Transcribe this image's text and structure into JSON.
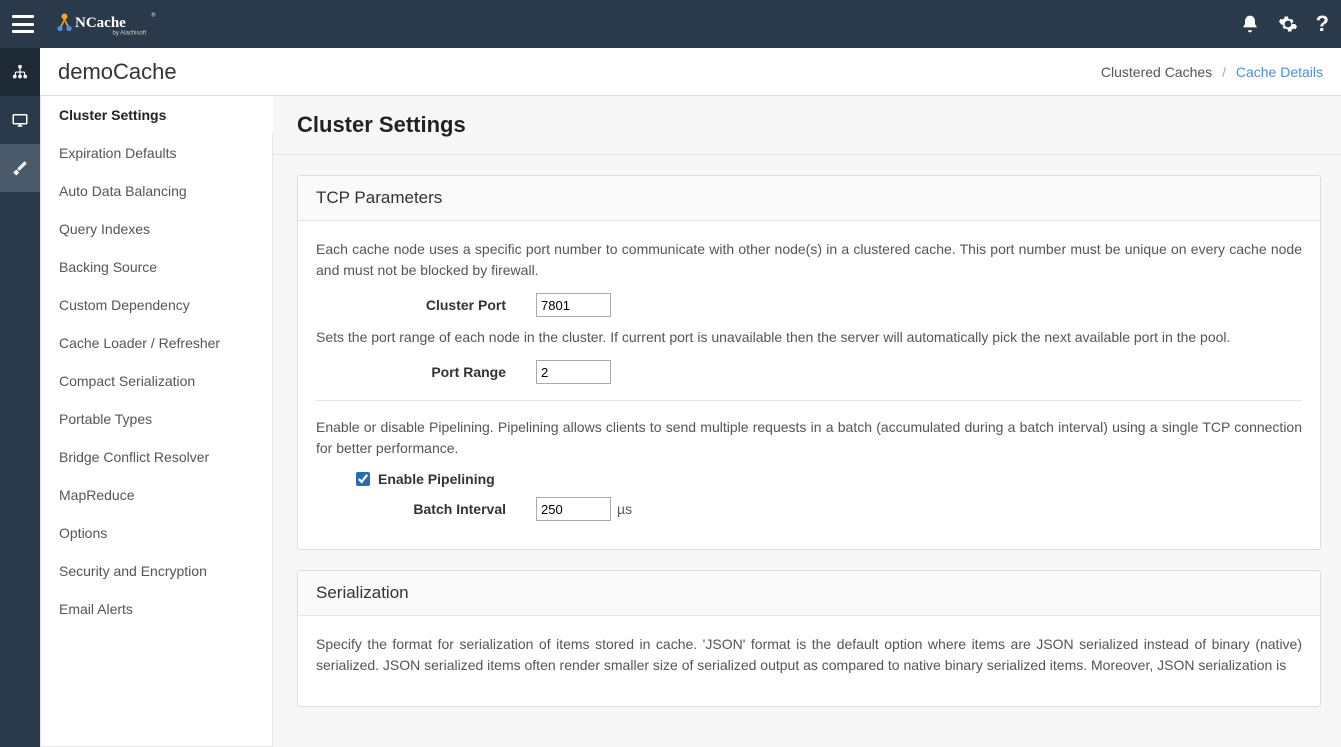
{
  "header": {
    "product": "NCache",
    "byline": "by Alachisoft"
  },
  "page": {
    "title": "demoCache"
  },
  "breadcrumb": {
    "root": "Clustered Caches",
    "current": "Cache Details"
  },
  "sidebar": {
    "items": [
      "Cluster Settings",
      "Expiration Defaults",
      "Auto Data Balancing",
      "Query Indexes",
      "Backing Source",
      "Custom Dependency",
      "Cache Loader / Refresher",
      "Compact Serialization",
      "Portable Types",
      "Bridge Conflict Resolver",
      "MapReduce",
      "Options",
      "Security and Encryption",
      "Email Alerts"
    ],
    "activeIndex": 0
  },
  "main": {
    "title": "Cluster Settings",
    "tcp": {
      "heading": "TCP Parameters",
      "desc1": "Each cache node uses a specific port number to communicate with other node(s) in a clustered cache. This port number must be unique on every cache node and must not be blocked by firewall.",
      "clusterPortLabel": "Cluster Port",
      "clusterPortValue": "7801",
      "desc2": "Sets the port range of each node in the cluster. If current port is unavailable then the server will automatically pick the next available port in the pool.",
      "portRangeLabel": "Port Range",
      "portRangeValue": "2",
      "desc3": "Enable or disable Pipelining. Pipelining allows clients to send multiple requests in a batch (accumulated during a batch interval) using a single TCP connection for better performance.",
      "enablePipeliningLabel": "Enable Pipelining",
      "enablePipeliningChecked": true,
      "batchIntervalLabel": "Batch Interval",
      "batchIntervalValue": "250",
      "batchIntervalUnit": "µs"
    },
    "serialization": {
      "heading": "Serialization",
      "desc": "Specify the format for serialization of items stored in cache. 'JSON' format is the default option where items are JSON serialized instead of binary (native) serialized. JSON serialized items often render smaller size of serialized output as compared to native binary serialized items. Moreover, JSON serialization is"
    }
  }
}
